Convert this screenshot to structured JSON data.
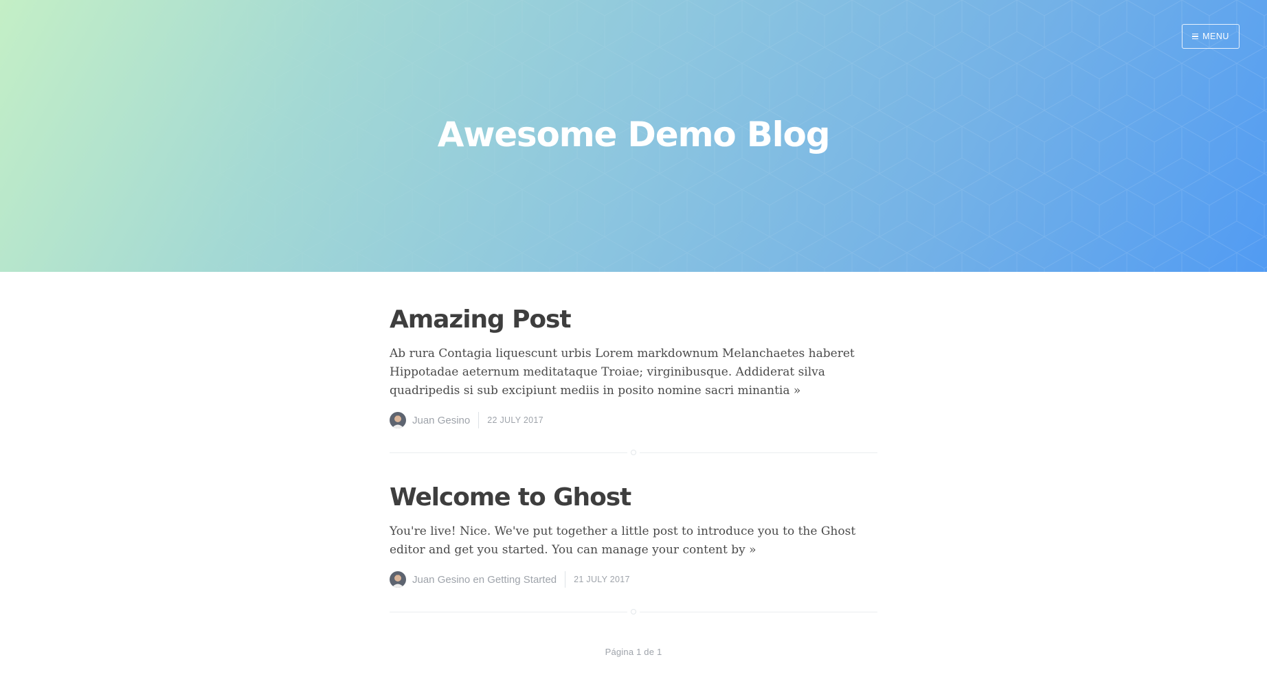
{
  "header": {
    "blog_title": "Awesome Demo Blog",
    "menu_label": "MENU",
    "gradient_colors": [
      "#c4efc6",
      "#8dc6df",
      "#519bf3"
    ]
  },
  "posts": [
    {
      "title": "Amazing Post",
      "excerpt": "Ab rura Contagia liquescunt urbis Lorem markdownum Melanchaetes haberet Hippotadae aeternum meditataque Troiae; virginibusque. Addiderat silva quadripedis si sub excipiunt mediis in posito nomine sacri minantia »",
      "author": "Juan Gesino",
      "date": "22 JULY 2017"
    },
    {
      "title": "Welcome to Ghost",
      "excerpt": "You're live! Nice. We've put together a little post to introduce you to the Ghost editor and get you started. You can manage your content by »",
      "author": "Juan Gesino en Getting Started",
      "date": "21 JULY 2017"
    }
  ],
  "pagination": {
    "text": "Página 1 de 1"
  },
  "colors": {
    "title_text": "#3e3e3e",
    "body_text": "#4a4a4a",
    "meta_text": "#9ea3aa"
  }
}
